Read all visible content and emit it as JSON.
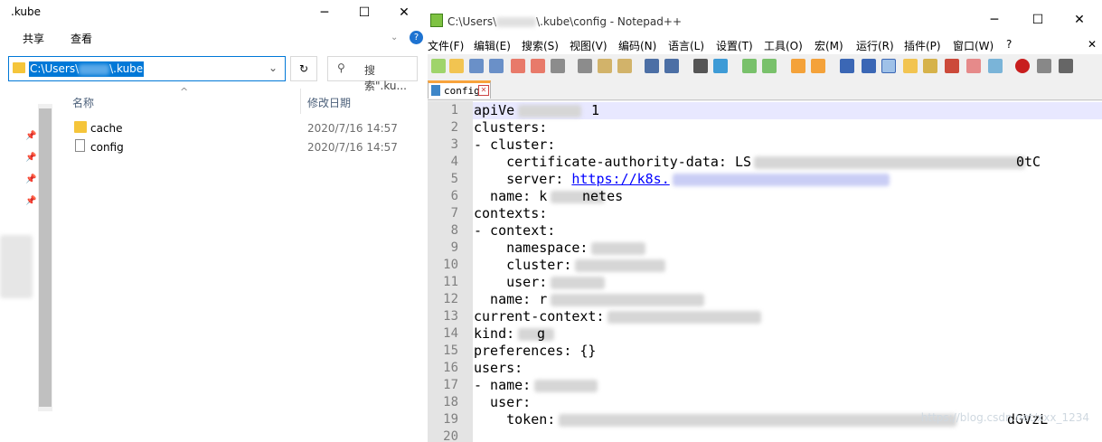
{
  "explorer": {
    "title": ".kube",
    "minimize": "─",
    "maximize": "☐",
    "close": "✕",
    "ribbon_tabs": [
      "共享",
      "查看"
    ],
    "address": {
      "value_prefix": "C:\\Users\\",
      "value_suffix": "\\.kube"
    },
    "search_placeholder": "搜索\".ku...",
    "columns": {
      "name": "名称",
      "modified": "修改日期"
    },
    "files": [
      {
        "name": "cache",
        "date": "2020/7/16 14:57",
        "icon": "folder-icon"
      },
      {
        "name": "config",
        "date": "2020/7/16 14:57",
        "icon": "file-icon"
      }
    ]
  },
  "npp": {
    "title": "C:\\Users\\         \\.kube\\config - Notepad++",
    "minimize": "─",
    "maximize": "☐",
    "close": "✕",
    "menu": [
      "文件(F)",
      "编辑(E)",
      "搜索(S)",
      "视图(V)",
      "编码(N)",
      "语言(L)",
      "设置(T)",
      "工具(O)",
      "宏(M)",
      "运行(R)",
      "插件(P)",
      "窗口(W)",
      "?"
    ],
    "tab_label": "config",
    "lines": [
      {
        "n": "1",
        "text": "apiVe",
        "blur_after": true,
        "tail": "1"
      },
      {
        "n": "2",
        "text": "clusters:"
      },
      {
        "n": "3",
        "text": "- cluster:"
      },
      {
        "n": "4",
        "text": "    certificate-authority-data: LS",
        "blur_after": true,
        "tail": "0tC"
      },
      {
        "n": "5",
        "text": "    server: ",
        "link": "https://k8s.",
        "blur_after": true
      },
      {
        "n": "6",
        "text": "  name: k",
        "blur_after": true,
        "tail": "netes"
      },
      {
        "n": "7",
        "text": "contexts:"
      },
      {
        "n": "8",
        "text": "- context:"
      },
      {
        "n": "9",
        "text": "    namespace:",
        "blur_after": true
      },
      {
        "n": "10",
        "text": "    cluster:",
        "blur_after": true
      },
      {
        "n": "11",
        "text": "    user:",
        "blur_after": true
      },
      {
        "n": "12",
        "text": "  name: r",
        "blur_after": true
      },
      {
        "n": "13",
        "text": "current-context:",
        "blur_after": true
      },
      {
        "n": "14",
        "text": "kind:",
        "blur_after": true,
        "tail": "g"
      },
      {
        "n": "15",
        "text": "preferences: {}"
      },
      {
        "n": "16",
        "text": "users:"
      },
      {
        "n": "17",
        "text": "- name:",
        "blur_after": true
      },
      {
        "n": "18",
        "text": "  user:"
      },
      {
        "n": "19",
        "text": "    token:",
        "blur_after": true,
        "tail": "dGVzL"
      },
      {
        "n": "20",
        "text": ""
      }
    ],
    "watermark": "https://blog.csdn.net/xxx_1234"
  }
}
